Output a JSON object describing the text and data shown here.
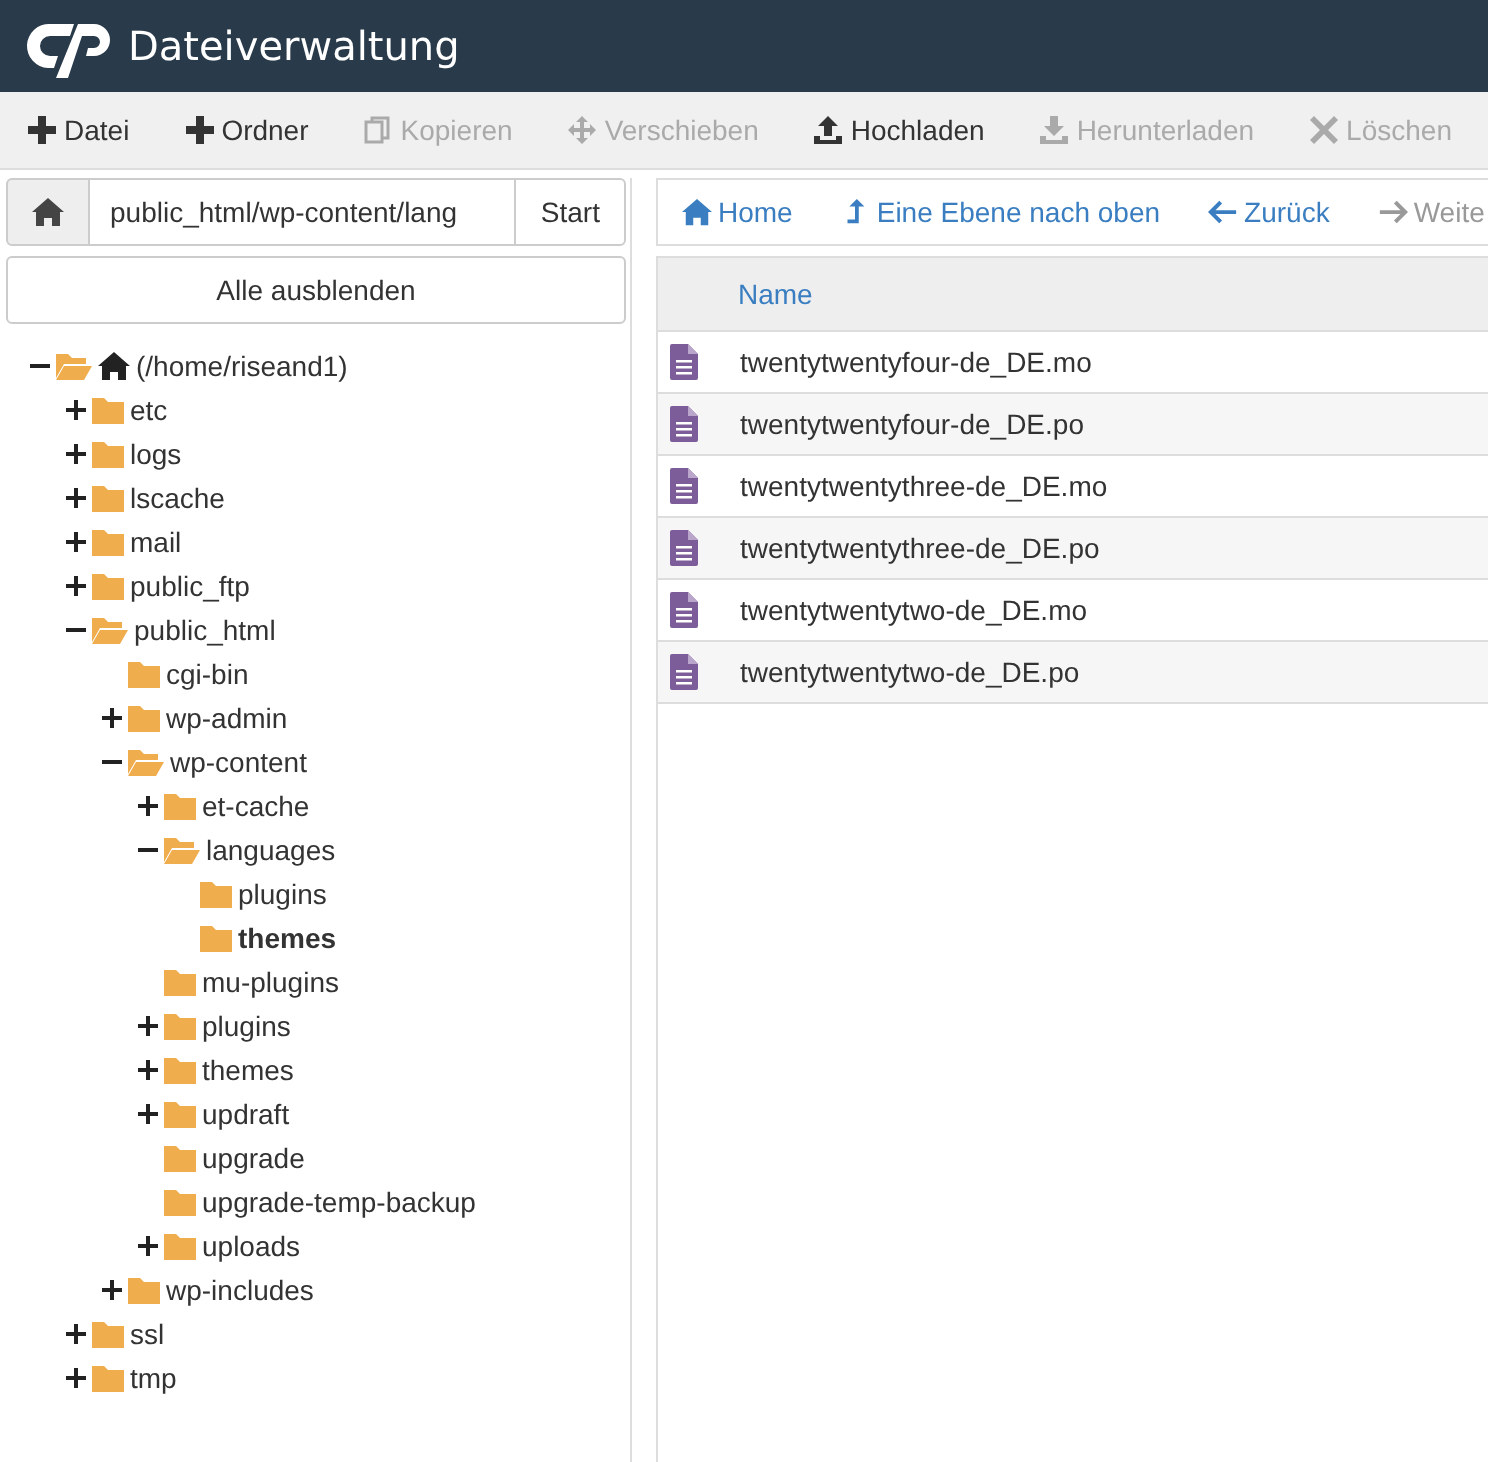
{
  "header": {
    "title": "Dateiverwaltung"
  },
  "toolbar": [
    {
      "kind": "plus",
      "label": "Datei",
      "disabled": false
    },
    {
      "kind": "plus",
      "label": "Ordner",
      "disabled": false
    },
    {
      "kind": "copy",
      "label": "Kopieren",
      "disabled": true
    },
    {
      "kind": "move",
      "label": "Verschieben",
      "disabled": true
    },
    {
      "kind": "upload",
      "label": "Hochladen",
      "disabled": false
    },
    {
      "kind": "download",
      "label": "Herunterladen",
      "disabled": true
    },
    {
      "kind": "delete",
      "label": "Löschen",
      "disabled": true
    }
  ],
  "path_bar": {
    "value": "public_html/wp-content/lang",
    "button": "Start"
  },
  "collapse_button": "Alle ausblenden",
  "tree": [
    {
      "kind": "home",
      "label": "(/home/riseand1)",
      "expandable": true,
      "expanded": true,
      "selected": false,
      "children": [
        {
          "label": "etc",
          "expandable": true,
          "expanded": false,
          "selected": false
        },
        {
          "label": "logs",
          "expandable": true,
          "expanded": false,
          "selected": false
        },
        {
          "label": "lscache",
          "expandable": true,
          "expanded": false,
          "selected": false
        },
        {
          "label": "mail",
          "expandable": true,
          "expanded": false,
          "selected": false
        },
        {
          "label": "public_ftp",
          "expandable": true,
          "expanded": false,
          "selected": false
        },
        {
          "label": "public_html",
          "expandable": true,
          "expanded": true,
          "selected": false,
          "children": [
            {
              "label": "cgi-bin",
              "expandable": false,
              "expanded": false,
              "selected": false
            },
            {
              "label": "wp-admin",
              "expandable": true,
              "expanded": false,
              "selected": false
            },
            {
              "label": "wp-content",
              "expandable": true,
              "expanded": true,
              "selected": false,
              "children": [
                {
                  "label": "et-cache",
                  "expandable": true,
                  "expanded": false,
                  "selected": false
                },
                {
                  "label": "languages",
                  "expandable": true,
                  "expanded": true,
                  "selected": false,
                  "children": [
                    {
                      "label": "plugins",
                      "expandable": false,
                      "expanded": false,
                      "selected": false
                    },
                    {
                      "label": "themes",
                      "expandable": false,
                      "expanded": false,
                      "selected": true
                    }
                  ]
                },
                {
                  "label": "mu-plugins",
                  "expandable": false,
                  "expanded": false,
                  "selected": false
                },
                {
                  "label": "plugins",
                  "expandable": true,
                  "expanded": false,
                  "selected": false
                },
                {
                  "label": "themes",
                  "expandable": true,
                  "expanded": false,
                  "selected": false
                },
                {
                  "label": "updraft",
                  "expandable": true,
                  "expanded": false,
                  "selected": false
                },
                {
                  "label": "upgrade",
                  "expandable": false,
                  "expanded": false,
                  "selected": false
                },
                {
                  "label": "upgrade-temp-backup",
                  "expandable": false,
                  "expanded": false,
                  "selected": false
                },
                {
                  "label": "uploads",
                  "expandable": true,
                  "expanded": false,
                  "selected": false
                }
              ]
            },
            {
              "label": "wp-includes",
              "expandable": true,
              "expanded": false,
              "selected": false
            }
          ]
        },
        {
          "label": "ssl",
          "expandable": true,
          "expanded": false,
          "selected": false
        },
        {
          "label": "tmp",
          "expandable": true,
          "expanded": false,
          "selected": false
        }
      ]
    }
  ],
  "nav": [
    {
      "kind": "home",
      "label": "Home"
    },
    {
      "kind": "up",
      "label": "Eine Ebene nach oben"
    },
    {
      "kind": "back",
      "label": "Zurück"
    },
    {
      "kind": "forward",
      "label": "Weite"
    }
  ],
  "table": {
    "columns": [
      "Name"
    ],
    "rows": [
      {
        "name": "twentytwentyfour-de_DE.mo"
      },
      {
        "name": "twentytwentyfour-de_DE.po"
      },
      {
        "name": "twentytwentythree-de_DE.mo"
      },
      {
        "name": "twentytwentythree-de_DE.po"
      },
      {
        "name": "twentytwentytwo-de_DE.mo"
      },
      {
        "name": "twentytwentytwo-de_DE.po"
      }
    ]
  }
}
